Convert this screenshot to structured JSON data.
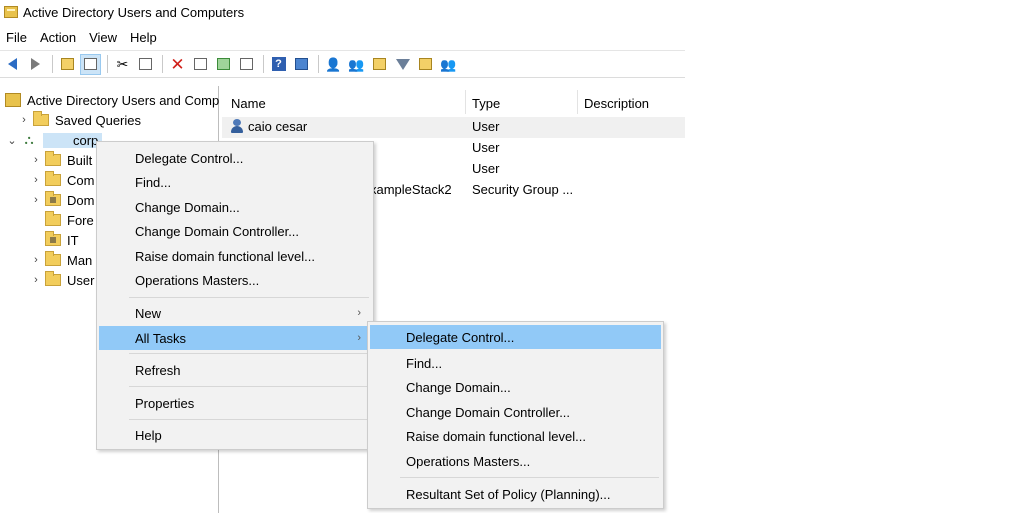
{
  "window": {
    "title": "Active Directory Users and Computers"
  },
  "menubar": [
    "File",
    "Action",
    "View",
    "Help"
  ],
  "toolbar": {
    "icons": [
      "back-icon",
      "forward-icon",
      "up-folder-icon",
      "show-hide-tree-icon",
      "cut-icon",
      "copy-icon",
      "delete-icon",
      "properties-icon",
      "refresh-icon",
      "export-list-icon",
      "help-icon",
      "show-action-pane-icon",
      "create-user-icon",
      "create-group-icon",
      "create-ou-icon",
      "filter-icon",
      "find-icon",
      "add-to-group-icon"
    ]
  },
  "tree": {
    "root": "Active Directory Users and Comp",
    "saved_queries": "Saved Queries",
    "domain": "corp",
    "children": [
      "Built",
      "Com",
      "Dom",
      "Fore",
      "IT",
      "Man",
      "User"
    ]
  },
  "list": {
    "columns": [
      "Name",
      "Type",
      "Description"
    ],
    "rows": [
      {
        "name": "caio cesar",
        "type": "User"
      },
      {
        "name": "",
        "type": "User"
      },
      {
        "name": "",
        "type": "User"
      },
      {
        "name": "xampleStack2",
        "type": "Security Group ..."
      }
    ]
  },
  "context_menu": {
    "items": [
      "Delegate Control...",
      "Find...",
      "Change Domain...",
      "Change Domain Controller...",
      "Raise domain functional level...",
      "Operations Masters..."
    ],
    "new": "New",
    "all_tasks": "All Tasks",
    "refresh": "Refresh",
    "properties": "Properties",
    "help": "Help",
    "submenu_arrow": "›"
  },
  "submenu": {
    "items": [
      "Delegate Control...",
      "Find...",
      "Change Domain...",
      "Change Domain Controller...",
      "Raise domain functional level...",
      "Operations Masters..."
    ],
    "rsop": "Resultant Set of Policy (Planning)..."
  },
  "colors": {
    "highlight": "#91c9f7",
    "menu_bg": "#f2f2f2",
    "selection": "#cce4f7"
  }
}
